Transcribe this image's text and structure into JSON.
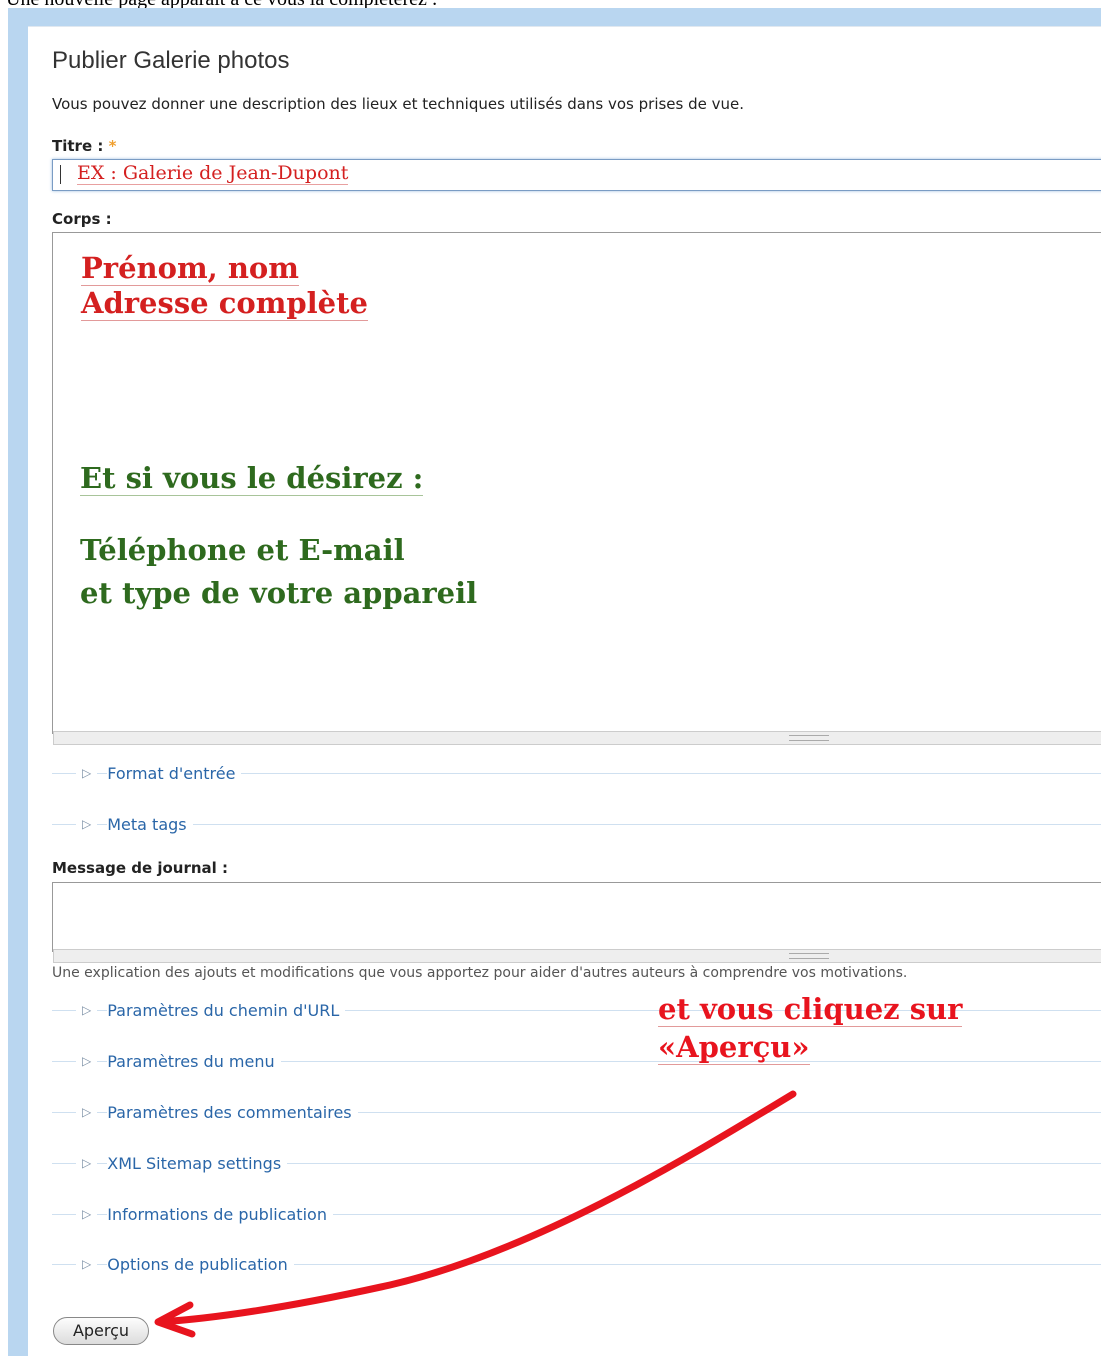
{
  "caption": "Une nouvelle page apparaît à ce vous la compléterez :",
  "page": {
    "title": "Publier Galerie photos",
    "description": "Vous pouvez donner une description des lieux et techniques utilisés dans vos prises de vue."
  },
  "form": {
    "title_label": "Titre :",
    "required_mark": "*",
    "title_value": "EX : Galerie de Jean-Dupont",
    "body_label": "Corps :",
    "body_lines": {
      "line1": "Prénom, nom",
      "line2": "Adresse complète",
      "line3": "Et si vous le désirez :",
      "line4": "Téléphone et E-mail",
      "line5": "et type de votre appareil"
    },
    "fieldsets_top": [
      "Format d'entrée",
      "Meta tags"
    ],
    "journal_label": "Message de journal :",
    "journal_help": "Une explication des ajouts et modifications que vous apportez pour aider d'autres auteurs à comprendre vos motivations.",
    "fieldsets_bottom": [
      "Paramètres du chemin d'URL",
      "Paramètres du menu",
      "Paramètres des commentaires",
      "XML Sitemap settings",
      "Informations de publication",
      "Options de publication"
    ],
    "preview_button": "Aperçu"
  },
  "annotation": {
    "line1": "et vous cliquez sur",
    "line2": "«Aperçu»",
    "color": "#e8141e"
  },
  "icons": {
    "collapsed": "triangle-right-icon"
  }
}
